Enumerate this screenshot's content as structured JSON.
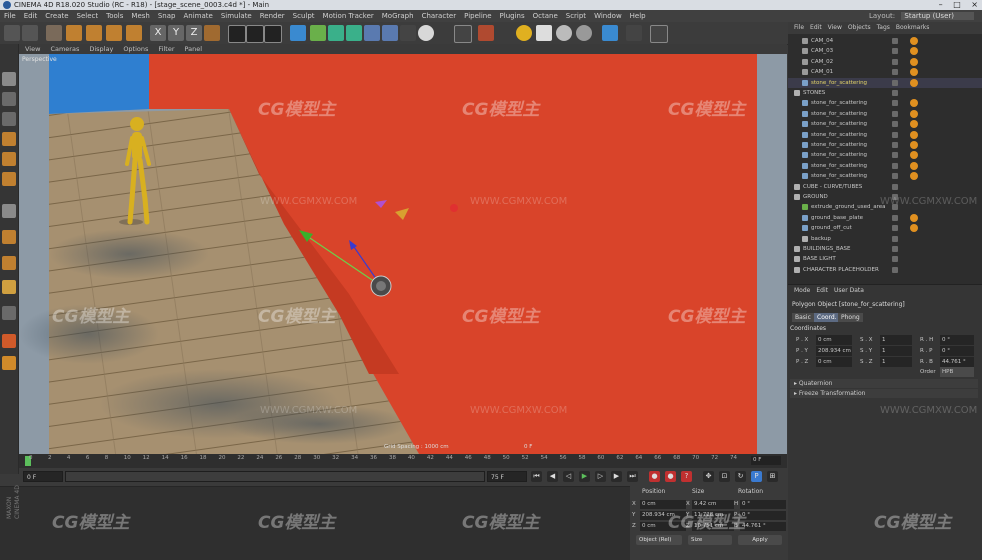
{
  "window": {
    "title": "CINEMA 4D R18.020 Studio (RC - R18) - [stage_scene_0003.c4d *] - Main",
    "controls": [
      "–",
      "□",
      "×"
    ]
  },
  "menu": [
    "File",
    "Edit",
    "Create",
    "Select",
    "Tools",
    "Mesh",
    "Snap",
    "Animate",
    "Simulate",
    "Render",
    "Sculpt",
    "Motion Tracker",
    "MoGraph",
    "Character",
    "Pipeline",
    "Plugins",
    "Octane",
    "Script",
    "Window",
    "Help"
  ],
  "layout": {
    "label": "Layout:",
    "value": "Startup (User)"
  },
  "viewport": {
    "menu": [
      "View",
      "Cameras",
      "Display",
      "Options",
      "Filter",
      "Panel"
    ],
    "label": "Perspective",
    "stat_left": "Grid Spacing : 1000 cm",
    "stat_right": "0 F"
  },
  "timeline": {
    "ticks": [
      "0",
      "2",
      "4",
      "6",
      "8",
      "10",
      "12",
      "14",
      "16",
      "18",
      "20",
      "22",
      "24",
      "26",
      "28",
      "30",
      "32",
      "34",
      "36",
      "38",
      "40",
      "42",
      "44",
      "46",
      "48",
      "50",
      "52",
      "54",
      "56",
      "58",
      "60",
      "62",
      "64",
      "66",
      "68",
      "70",
      "72",
      "74"
    ],
    "current_frame": "0 F"
  },
  "transport": {
    "start": "0 F",
    "end_left": "75 F",
    "end_right": "75 F"
  },
  "coord_panel": {
    "headers": [
      "Position",
      "Size",
      "Rotation"
    ],
    "rows": [
      {
        "axis": "X",
        "pos": "0 cm",
        "size_axis": "X",
        "size": "9.42 cm",
        "rot_axis": "H",
        "rot": "0 °"
      },
      {
        "axis": "Y",
        "pos": "208.934 cm",
        "size_axis": "Y",
        "size": "11.728 cm",
        "rot_axis": "P",
        "rot": "0 °"
      },
      {
        "axis": "Z",
        "pos": "0 cm",
        "size_axis": "Z",
        "size": "10.751 cm",
        "rot_axis": "B",
        "rot": "44.761 °"
      }
    ],
    "mode": "Object (Rel)",
    "size_mode": "Size",
    "apply": "Apply"
  },
  "brand": [
    "MAXON",
    "CINEMA 4D"
  ],
  "object_manager": {
    "menu": [
      "File",
      "Edit",
      "View",
      "Objects",
      "Tags",
      "Bookmarks"
    ],
    "rows": [
      {
        "name": "CAM_04",
        "indent": 1,
        "type": "cam"
      },
      {
        "name": "CAM_03",
        "indent": 1,
        "type": "cam"
      },
      {
        "name": "CAM_02",
        "indent": 1,
        "type": "cam"
      },
      {
        "name": "CAM_01",
        "indent": 1,
        "type": "cam"
      },
      {
        "name": "stone_for_scattering",
        "indent": 1,
        "type": "poly",
        "highlight": true
      },
      {
        "name": "STONES",
        "indent": 0,
        "type": "null"
      },
      {
        "name": "stone_for_scattering",
        "indent": 1,
        "type": "poly"
      },
      {
        "name": "stone_for_scattering",
        "indent": 1,
        "type": "poly"
      },
      {
        "name": "stone_for_scattering",
        "indent": 1,
        "type": "poly"
      },
      {
        "name": "stone_for_scattering",
        "indent": 1,
        "type": "poly"
      },
      {
        "name": "stone_for_scattering",
        "indent": 1,
        "type": "poly"
      },
      {
        "name": "stone_for_scattering",
        "indent": 1,
        "type": "poly"
      },
      {
        "name": "stone_for_scattering",
        "indent": 1,
        "type": "poly"
      },
      {
        "name": "stone_for_scattering",
        "indent": 1,
        "type": "poly"
      },
      {
        "name": "CUBE - CURVE/TUBES",
        "indent": 0,
        "type": "null"
      },
      {
        "name": "GROUND",
        "indent": 0,
        "type": "null"
      },
      {
        "name": "extrude_ground_used_area",
        "indent": 1,
        "type": "gen"
      },
      {
        "name": "ground_base_plate",
        "indent": 1,
        "type": "poly"
      },
      {
        "name": "ground_off_cut",
        "indent": 1,
        "type": "poly"
      },
      {
        "name": "backup",
        "indent": 1,
        "type": "null"
      },
      {
        "name": "BUILDINGS_BASE",
        "indent": 0,
        "type": "null"
      },
      {
        "name": "BASE LIGHT",
        "indent": 0,
        "type": "null"
      },
      {
        "name": "CHARACTER PLACEHOLDER",
        "indent": 0,
        "type": "null"
      }
    ]
  },
  "attributes": {
    "menu": [
      "Mode",
      "Edit",
      "User Data"
    ],
    "title": "Polygon Object [stone_for_scattering]",
    "tabs": [
      "Basic",
      "Coord.",
      "Phong"
    ],
    "active_tab": "Coord.",
    "section": "Coordinates",
    "rows": [
      {
        "pl": "P . X",
        "pv": "0 cm",
        "sl": "S . X",
        "sv": "1",
        "rl": "R . H",
        "rv": "0 °"
      },
      {
        "pl": "P . Y",
        "pv": "208.934 cm",
        "sl": "S . Y",
        "sv": "1",
        "rl": "R . P",
        "rv": "0 °"
      },
      {
        "pl": "P . Z",
        "pv": "0 cm",
        "sl": "S . Z",
        "sv": "1",
        "rl": "R . B",
        "rv": "44.761 °"
      }
    ],
    "order_label": "Order",
    "order_value": "HPB",
    "folds": [
      "Quaternion",
      "Freeze Transformation"
    ]
  },
  "watermark": {
    "logo": "CG模型主",
    "url": "WWW.CGMXW.COM"
  },
  "colors": {
    "wall": "#d9442a",
    "floor": "#a08c6e",
    "sky": "#2f7fd0",
    "figure": "#d8b020"
  }
}
